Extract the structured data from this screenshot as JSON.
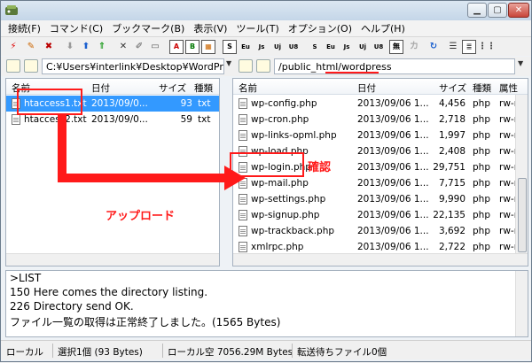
{
  "window": {
    "title": ""
  },
  "menu": [
    "接続(F)",
    "コマンド(C)",
    "ブックマーク(B)",
    "表示(V)",
    "ツール(T)",
    "オプション(O)",
    "ヘルプ(H)"
  ],
  "toolbar": {
    "glyphs": [
      "A",
      "B",
      "S",
      "S",
      "Eu",
      "Js",
      "Uj",
      "U8",
      "S",
      "Eu",
      "Js",
      "Uj",
      "U8",
      "無",
      "カ"
    ]
  },
  "local": {
    "path": "C:¥Users¥interlink¥Desktop¥WordPress",
    "columns": [
      "名前",
      "日付",
      "サイズ",
      "種類"
    ],
    "files": [
      {
        "name": "htaccess1.txt",
        "date": "2013/09/0...",
        "size": "93",
        "type": "txt",
        "selected": true
      },
      {
        "name": "htaccess2.txt",
        "date": "2013/09/0...",
        "size": "59",
        "type": "txt",
        "selected": false
      }
    ]
  },
  "remote": {
    "path": "/public_html/wordpress",
    "columns": [
      "名前",
      "日付",
      "サイズ",
      "種類",
      "属性"
    ],
    "files": [
      {
        "name": "wp-config.php",
        "date": "2013/09/06 1...",
        "size": "4,456",
        "type": "php",
        "attr": "rw-r"
      },
      {
        "name": "wp-cron.php",
        "date": "2013/09/06 1...",
        "size": "2,718",
        "type": "php",
        "attr": "rw-r"
      },
      {
        "name": "wp-links-opml.php",
        "date": "2013/09/06 1...",
        "size": "1,997",
        "type": "php",
        "attr": "rw-r"
      },
      {
        "name": "wp-load.php",
        "date": "2013/09/06 1...",
        "size": "2,408",
        "type": "php",
        "attr": "rw-r"
      },
      {
        "name": "wp-login.php",
        "date": "2013/09/06 1...",
        "size": "29,751",
        "type": "php",
        "attr": "rw-r"
      },
      {
        "name": "wp-mail.php",
        "date": "2013/09/06 1...",
        "size": "7,715",
        "type": "php",
        "attr": "rw-r"
      },
      {
        "name": "wp-settings.php",
        "date": "2013/09/06 1...",
        "size": "9,990",
        "type": "php",
        "attr": "rw-r"
      },
      {
        "name": "wp-signup.php",
        "date": "2013/09/06 1...",
        "size": "22,135",
        "type": "php",
        "attr": "rw-r"
      },
      {
        "name": "wp-trackback.php",
        "date": "2013/09/06 1...",
        "size": "3,692",
        "type": "php",
        "attr": "rw-r"
      },
      {
        "name": "xmlrpc.php",
        "date": "2013/09/06 1...",
        "size": "2,722",
        "type": "php",
        "attr": "rw-r"
      }
    ]
  },
  "log": [
    ">LIST",
    "150 Here comes the directory listing.",
    "226 Directory send OK.",
    "ファイル一覧の取得は正常終了しました。(1565 Bytes)"
  ],
  "status": {
    "mode": "ローカル",
    "selection": "選択1個 (93 Bytes)",
    "free": "ローカル空 7056.29M Bytes",
    "queue": "転送待ちファイル0個"
  },
  "annotations": {
    "upload_label": "アップロード",
    "confirm_label": "確認",
    "color": "#ff1a1a"
  }
}
